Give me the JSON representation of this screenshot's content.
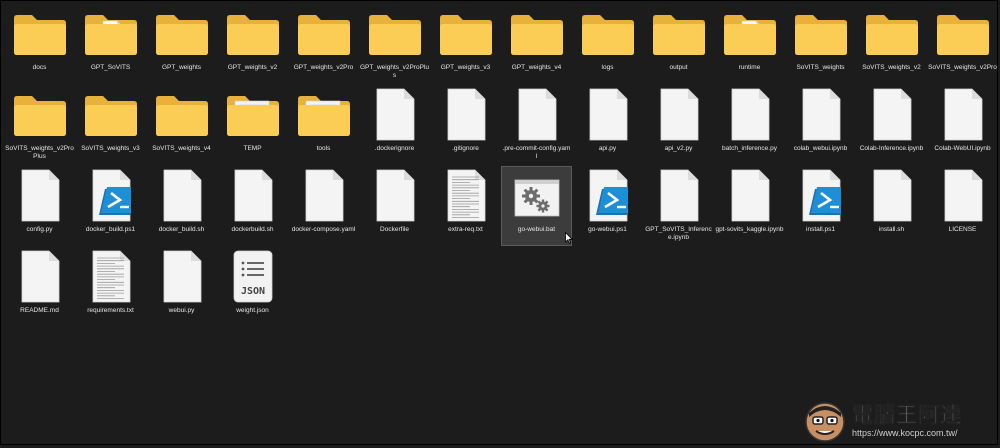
{
  "items": [
    {
      "name": "docs",
      "kind": "folder"
    },
    {
      "name": "GPT_SoVITS",
      "kind": "folder-doc"
    },
    {
      "name": "GPT_weights",
      "kind": "folder"
    },
    {
      "name": "GPT_weights_v2",
      "kind": "folder"
    },
    {
      "name": "GPT_weights_v2Pro",
      "kind": "folder"
    },
    {
      "name": "GPT_weights_v2ProPlus",
      "kind": "folder"
    },
    {
      "name": "GPT_weights_v3",
      "kind": "folder"
    },
    {
      "name": "GPT_weights_v4",
      "kind": "folder"
    },
    {
      "name": "logs",
      "kind": "folder"
    },
    {
      "name": "output",
      "kind": "folder"
    },
    {
      "name": "runtime",
      "kind": "folder-doc"
    },
    {
      "name": "SoVITS_weights",
      "kind": "folder"
    },
    {
      "name": "SoVITS_weights_v2",
      "kind": "folder"
    },
    {
      "name": "SoVITS_weights_v2Pro",
      "kind": "folder"
    },
    {
      "name": "SoVITS_weights_v2ProPlus",
      "kind": "folder"
    },
    {
      "name": "SoVITS_weights_v3",
      "kind": "folder"
    },
    {
      "name": "SoVITS_weights_v4",
      "kind": "folder"
    },
    {
      "name": "TEMP",
      "kind": "folder-img"
    },
    {
      "name": "tools",
      "kind": "folder-img"
    },
    {
      "name": ".dockerignore",
      "kind": "file"
    },
    {
      "name": ".gitignore",
      "kind": "file"
    },
    {
      "name": ".pre-commit-config.yaml",
      "kind": "file"
    },
    {
      "name": "api.py",
      "kind": "file"
    },
    {
      "name": "api_v2.py",
      "kind": "file"
    },
    {
      "name": "batch_inference.py",
      "kind": "file"
    },
    {
      "name": "colab_webui.ipynb",
      "kind": "file"
    },
    {
      "name": "Colab-Inference.ipynb",
      "kind": "file"
    },
    {
      "name": "Colab-WebUI.ipynb",
      "kind": "file"
    },
    {
      "name": "config.py",
      "kind": "file"
    },
    {
      "name": "docker_build.ps1",
      "kind": "ps1"
    },
    {
      "name": "docker_build.sh",
      "kind": "file"
    },
    {
      "name": "dockerbuild.sh",
      "kind": "file"
    },
    {
      "name": "docker-compose.yaml",
      "kind": "file"
    },
    {
      "name": "Dockerfile",
      "kind": "file"
    },
    {
      "name": "extra-req.txt",
      "kind": "txt"
    },
    {
      "name": "go-webui.bat",
      "kind": "bat",
      "selected": true
    },
    {
      "name": "go-webui.ps1",
      "kind": "ps1"
    },
    {
      "name": "GPT_SoVITS_Inference.ipynb",
      "kind": "file"
    },
    {
      "name": "gpt-sovits_kaggle.ipynb",
      "kind": "file"
    },
    {
      "name": "install.ps1",
      "kind": "ps1"
    },
    {
      "name": "install.sh",
      "kind": "file"
    },
    {
      "name": "LICENSE",
      "kind": "file"
    },
    {
      "name": "README.md",
      "kind": "file"
    },
    {
      "name": "requirements.txt",
      "kind": "txt"
    },
    {
      "name": "webui.py",
      "kind": "file"
    },
    {
      "name": "weight.json",
      "kind": "json"
    }
  ],
  "json_badge": "JSON",
  "watermark": {
    "title": "電腦王阿達",
    "url": "https://www.kocpc.com.tw/"
  },
  "colors": {
    "background": "#1c1c1c",
    "folder_back": "#e8b23a",
    "folder_front": "#fccd55",
    "file": "#f4f4f4",
    "ps_blue": "#1e8fd6"
  }
}
